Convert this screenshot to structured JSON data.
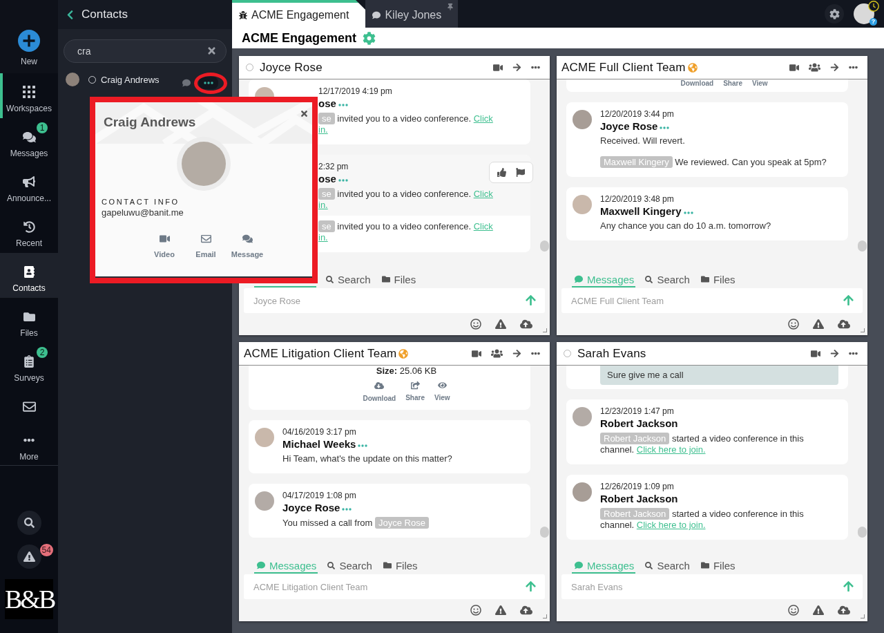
{
  "nav": {
    "items": [
      {
        "kind": "new",
        "label": "New",
        "selected": false,
        "current": false
      },
      {
        "kind": "workspaces",
        "label": "Workspaces",
        "selected": false,
        "current": true
      },
      {
        "kind": "messages",
        "label": "Messages",
        "badge": "1",
        "selected": false,
        "current": false
      },
      {
        "kind": "announcements",
        "label": "Announce...",
        "selected": false,
        "current": false
      },
      {
        "kind": "recent",
        "label": "Recent",
        "selected": false,
        "current": false
      },
      {
        "kind": "contacts",
        "label": "Contacts",
        "selected": true,
        "current": false
      },
      {
        "kind": "files",
        "label": "Files",
        "selected": false,
        "current": false
      },
      {
        "kind": "surveys",
        "label": "Surveys",
        "badge": "2",
        "selected": false,
        "current": false
      },
      {
        "kind": "email",
        "selected": false,
        "current": false
      },
      {
        "kind": "more",
        "label": "More",
        "selected": false,
        "current": false
      }
    ],
    "tools": [
      {
        "kind": "search"
      },
      {
        "kind": "alerts",
        "badge": "54"
      }
    ],
    "logo": "B&B"
  },
  "contacts": {
    "title": "Contacts",
    "search": {
      "value": "cra"
    },
    "results": [
      {
        "name": "Craig Andrews",
        "online": false,
        "selected": false
      }
    ]
  },
  "contact_card": {
    "name": "Craig Andrews",
    "section": "CONTACT INFO",
    "email": "gapeluwu@banit.me",
    "actions": [
      {
        "kind": "video",
        "label": "Video"
      },
      {
        "kind": "email",
        "label": "Email"
      },
      {
        "kind": "message",
        "label": "Message"
      }
    ]
  },
  "tabs": [
    {
      "kind": "workspace",
      "label": "ACME Engagement",
      "selected": true,
      "pinned": false
    },
    {
      "kind": "chat",
      "label": "Kiley Jones",
      "selected": false,
      "pinned": true
    }
  ],
  "account": {
    "help_badge": "?"
  },
  "workspace": {
    "title": "ACME Engagement"
  },
  "panels": [
    {
      "kind": "direct",
      "title": "Joyce Rose",
      "online": false,
      "covered": true,
      "feed": [
        {
          "kind": "message",
          "avatar": true,
          "date": "12/17/2019 4:19 pm",
          "author": "ose",
          "author_menu": true,
          "rows": [
            {
              "hovered": false,
              "segments": [
                {
                  "kind": "chip",
                  "text": "se"
                },
                {
                  "kind": "text",
                  "text": "invited you to a video conference."
                },
                {
                  "kind": "link",
                  "text": "Click"
                },
                {
                  "kind": "break"
                },
                {
                  "kind": "link",
                  "text": "in."
                }
              ]
            }
          ]
        },
        {
          "kind": "message",
          "avatar": false,
          "date": "2:32 pm",
          "author": "ose",
          "author_menu": true,
          "rows": [
            {
              "hovered": true,
              "segments": [
                {
                  "kind": "chip",
                  "text": "se"
                },
                {
                  "kind": "text",
                  "text": "invited you to a video conference."
                },
                {
                  "kind": "link",
                  "text": "Click"
                },
                {
                  "kind": "break"
                },
                {
                  "kind": "link",
                  "text": "in."
                }
              ]
            },
            {
              "hovered": false,
              "segments": [
                {
                  "kind": "chip",
                  "text": "se"
                },
                {
                  "kind": "text",
                  "text": "invited you to a video conference."
                },
                {
                  "kind": "link",
                  "text": "Click"
                },
                {
                  "kind": "break"
                },
                {
                  "kind": "link",
                  "text": "in."
                }
              ]
            }
          ]
        }
      ],
      "tabs": [
        {
          "kind": "messages",
          "selected": true
        },
        {
          "kind": "search",
          "label": "Search",
          "selected": false
        },
        {
          "kind": "files",
          "label": "Files",
          "selected": false
        }
      ],
      "composer": {
        "placeholder": "Joyce Rose"
      }
    },
    {
      "kind": "team",
      "title": "ACME Full Client Team",
      "covered": false,
      "feed": [
        {
          "kind": "file",
          "show_icons": false,
          "actions": [
            {
              "kind": "download",
              "label": "Download"
            },
            {
              "kind": "share",
              "label": "Share"
            },
            {
              "kind": "view",
              "label": "View"
            }
          ]
        },
        {
          "kind": "message",
          "avatar": true,
          "date": "12/20/2019 3:44 pm",
          "author": "Joyce Rose",
          "author_menu": true,
          "rows": [
            {
              "hovered": false,
              "segments": [
                {
                  "kind": "text",
                  "text": "Received. Will revert."
                }
              ]
            },
            {
              "hovered": false,
              "segments": [
                {
                  "kind": "chip",
                  "text": "Maxwell Kingery"
                },
                {
                  "kind": "text",
                  "text": "We reviewed. Can you speak at 5pm?"
                }
              ]
            }
          ]
        },
        {
          "kind": "message",
          "avatar": true,
          "date": "12/20/2019 3:48 pm",
          "author": "Maxwell Kingery",
          "author_menu": true,
          "rows": [
            {
              "hovered": false,
              "segments": [
                {
                  "kind": "text",
                  "text": "Any chance you can do 10 a.m. tomorrow?"
                }
              ]
            }
          ]
        }
      ],
      "tabs": [
        {
          "kind": "messages",
          "label": "Messages",
          "selected": true
        },
        {
          "kind": "search",
          "label": "Search",
          "selected": false
        },
        {
          "kind": "files",
          "label": "Files",
          "selected": false
        }
      ],
      "composer": {
        "placeholder": "ACME Full Client Team"
      }
    },
    {
      "kind": "team",
      "title": "ACME Litigation Client Team",
      "covered": false,
      "feed": [
        {
          "kind": "file",
          "size": "**Size:** 25.06 KB",
          "show_icons": true,
          "actions": [
            {
              "kind": "download",
              "label": "Download"
            },
            {
              "kind": "share",
              "label": "Share"
            },
            {
              "kind": "view",
              "label": "View"
            }
          ]
        },
        {
          "kind": "message",
          "avatar": true,
          "date": "04/16/2019 3:17 pm",
          "author": "Michael Weeks",
          "author_menu": true,
          "rows": [
            {
              "hovered": false,
              "segments": [
                {
                  "kind": "text",
                  "text": "Hi Team, what's the update on this matter?"
                }
              ]
            }
          ]
        },
        {
          "kind": "message",
          "avatar": true,
          "date": "04/17/2019 1:08 pm",
          "author": "Joyce Rose",
          "author_menu": true,
          "rows": [
            {
              "hovered": false,
              "segments": [
                {
                  "kind": "text",
                  "text": "You missed a call from"
                },
                {
                  "kind": "chip",
                  "text": "Joyce Rose"
                }
              ]
            }
          ]
        }
      ],
      "tabs": [
        {
          "kind": "messages",
          "label": "Messages",
          "selected": true
        },
        {
          "kind": "search",
          "label": "Search",
          "selected": false
        },
        {
          "kind": "files",
          "label": "Files",
          "selected": false
        }
      ],
      "composer": {
        "placeholder": "ACME Litigation Client Team"
      }
    },
    {
      "kind": "direct",
      "title": "Sarah Evans",
      "online": false,
      "covered": false,
      "feed": [
        {
          "kind": "own",
          "text": "Sure give me a call"
        },
        {
          "kind": "message",
          "avatar": true,
          "date": "12/23/2019 1:47 pm",
          "author": "Robert Jackson",
          "author_menu": false,
          "rows": [
            {
              "hovered": false,
              "segments": [
                {
                  "kind": "chip",
                  "text": "Robert Jackson"
                },
                {
                  "kind": "text",
                  "text": "started a video conference in this channel."
                },
                {
                  "kind": "link",
                  "text": "Click here to join."
                }
              ]
            }
          ]
        },
        {
          "kind": "message",
          "avatar": true,
          "date": "12/26/2019 1:09 pm",
          "author": "Robert Jackson",
          "author_menu": false,
          "rows": [
            {
              "hovered": false,
              "segments": [
                {
                  "kind": "chip",
                  "text": "Robert Jackson"
                },
                {
                  "kind": "text",
                  "text": "started a video conference in this channel."
                },
                {
                  "kind": "link",
                  "text": "Click here to join."
                }
              ]
            }
          ]
        }
      ],
      "tabs": [
        {
          "kind": "messages",
          "label": "Messages",
          "selected": true
        },
        {
          "kind": "search",
          "label": "Search",
          "selected": false
        },
        {
          "kind": "files",
          "label": "Files",
          "selected": false
        }
      ],
      "composer": {
        "placeholder": "Sarah Evans"
      }
    }
  ]
}
